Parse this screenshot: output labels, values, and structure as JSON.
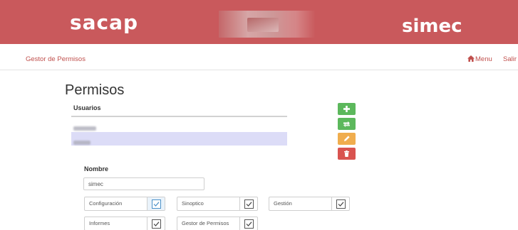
{
  "banner": {
    "logo_left": "sacap",
    "logo_right": "simec",
    "brand_color": "#c9595c"
  },
  "navbar": {
    "brand": "Gestor de Permisos",
    "menu_label": "Menu",
    "menu_icon": "home-icon",
    "salir_label": "Salir",
    "link_color": "#c0504d"
  },
  "main": {
    "title": "Permisos",
    "users": {
      "header": "Usuarios",
      "selected_index": 1
    },
    "actions": [
      {
        "name": "add",
        "icon": "plus-icon",
        "color": "#5cb85c"
      },
      {
        "name": "swap",
        "icon": "swap-icon",
        "color": "#5cb85c"
      },
      {
        "name": "edit",
        "icon": "pencil-icon",
        "color": "#f0ad4e"
      },
      {
        "name": "delete",
        "icon": "trash-icon",
        "color": "#d9534f"
      }
    ],
    "form": {
      "nombre_label": "Nombre",
      "nombre_value": "simec",
      "permissions": [
        {
          "label": "Configuración",
          "checked": true
        },
        {
          "label": "Sinoptico",
          "checked": true
        },
        {
          "label": "Gestión",
          "checked": true
        },
        {
          "label": "Informes",
          "checked": true
        },
        {
          "label": "Gestor de Permisos",
          "checked": true
        }
      ]
    }
  }
}
